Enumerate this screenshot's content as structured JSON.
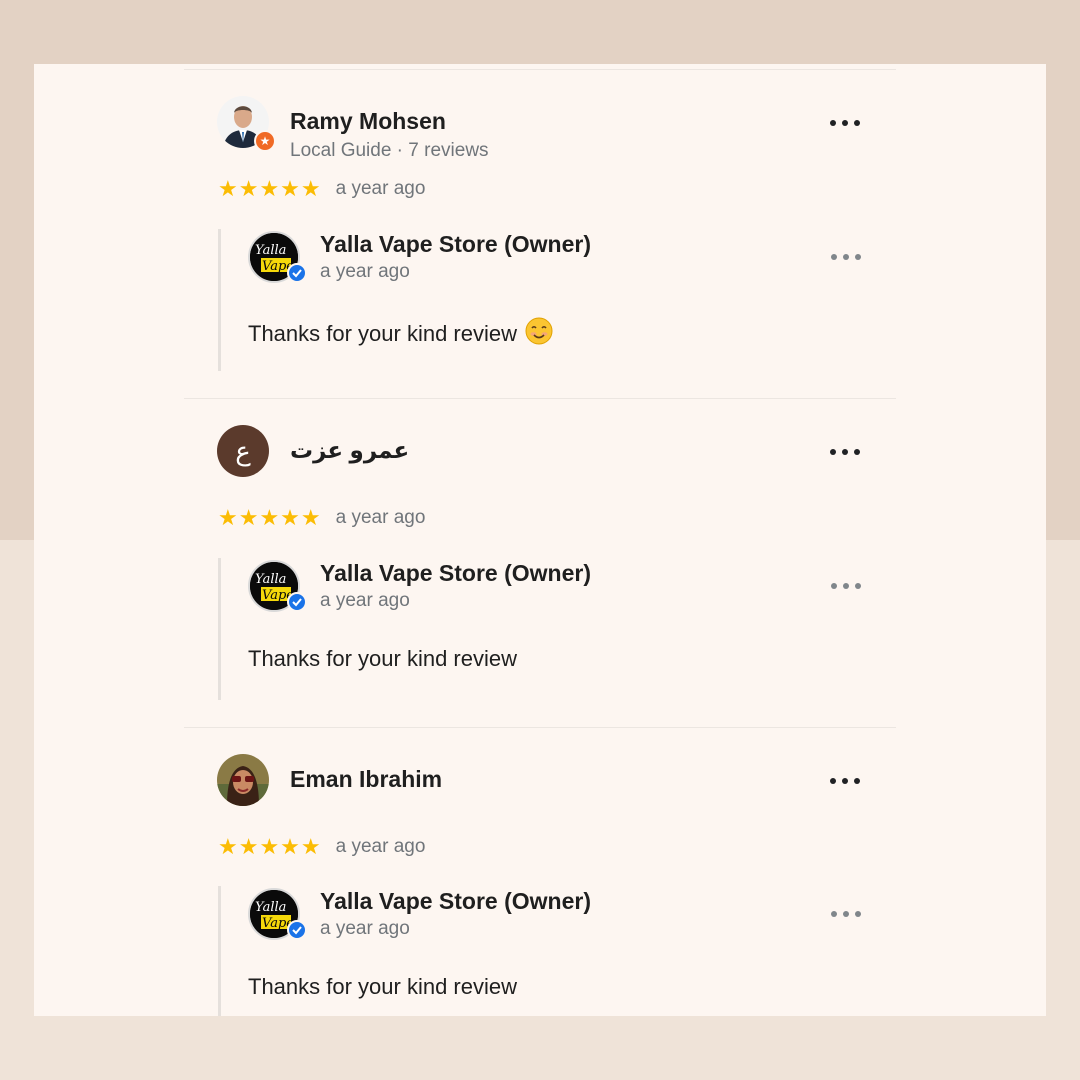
{
  "reviews": [
    {
      "name": "Ramy Mohsen",
      "meta": "Local Guide · 7 reviews",
      "stars": "★★★★★",
      "rating": 5,
      "time": "a year ago",
      "avatar_icon": "user-photo-icon",
      "reply": {
        "owner": "Yalla Vape Store (Owner)",
        "time": "a year ago",
        "text": "Thanks for your kind review",
        "emoji": "smiling-face-icon",
        "logo_text": [
          "Yalla",
          "Vape"
        ]
      }
    },
    {
      "name": "عمرو عزت",
      "initial": "ع",
      "stars": "★★★★★",
      "rating": 5,
      "time": "a year ago",
      "avatar_color": "#5b3a2c",
      "reply": {
        "owner": "Yalla Vape Store (Owner)",
        "time": "a year ago",
        "text": "Thanks for your kind review",
        "logo_text": [
          "Yalla",
          "Vape"
        ]
      }
    },
    {
      "name": "Eman Ibrahim",
      "stars": "★★★★★",
      "rating": 5,
      "time": "a year ago",
      "avatar_icon": "user-photo-icon",
      "reply": {
        "owner": "Yalla Vape Store (Owner)",
        "time": "a year ago",
        "text": "Thanks for your kind review",
        "logo_text": [
          "Yalla",
          "Vape"
        ]
      }
    }
  ],
  "colors": {
    "star": "#fbbc04",
    "guide_badge": "#f06a25",
    "verified": "#1a73e8",
    "panel_bg": "#fdf6f1"
  },
  "icons": {
    "more": "more-horizontal-icon",
    "guide": "local-guide-star-icon",
    "verified": "verified-check-icon"
  }
}
